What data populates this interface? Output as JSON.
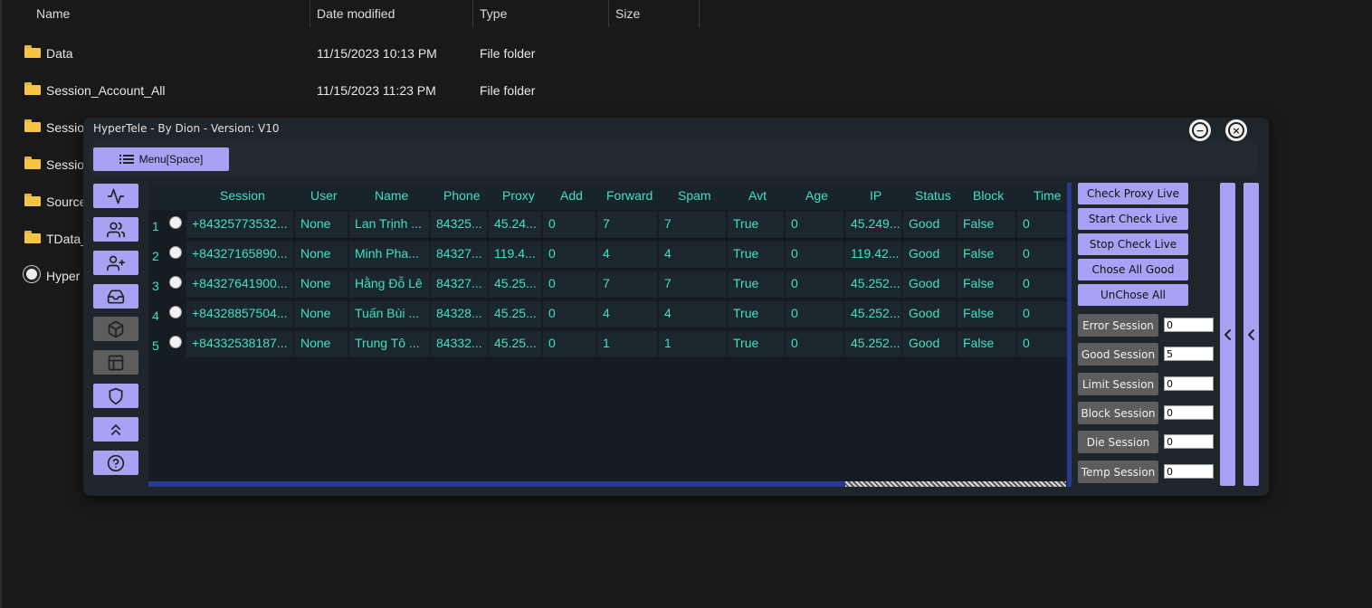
{
  "explorer": {
    "columns": {
      "name": "Name",
      "date": "Date modified",
      "type": "Type",
      "size": "Size"
    },
    "rows": [
      {
        "name": "Data",
        "date": "11/15/2023 10:13 PM",
        "type": "File folder"
      },
      {
        "name": "Session_Account_All",
        "date": "11/15/2023 11:23 PM",
        "type": "File folder"
      },
      {
        "name": "Sessio",
        "date": "",
        "type": ""
      },
      {
        "name": "Sessio",
        "date": "",
        "type": ""
      },
      {
        "name": "Source",
        "date": "",
        "type": ""
      },
      {
        "name": "TData_",
        "date": "",
        "type": ""
      },
      {
        "name": "Hyper",
        "date": "",
        "type": ""
      }
    ]
  },
  "window": {
    "title": "HyperTele - By Dion - Version: V10",
    "minimize_icon": "minus-circle-icon",
    "close_icon": "x-circle-icon"
  },
  "menu": {
    "label": "Menu[Space]",
    "icon": "menu-icon"
  },
  "nav": [
    {
      "icon": "activity-icon"
    },
    {
      "icon": "users-icon"
    },
    {
      "icon": "user-plus-icon"
    },
    {
      "icon": "inbox-icon"
    },
    {
      "icon": "box-icon"
    },
    {
      "icon": "layout-icon"
    },
    {
      "icon": "shield-icon"
    },
    {
      "icon": "chevrons-up-icon"
    },
    {
      "icon": "help-circle-icon"
    }
  ],
  "table": {
    "headers": [
      "Session",
      "User",
      "Name",
      "Phone",
      "Proxy",
      "Add",
      "Forward",
      "Spam",
      "Avt",
      "Age",
      "IP",
      "Status",
      "Block",
      "Time"
    ],
    "rows": [
      {
        "num": "1",
        "cells": [
          "+84325773532...",
          "None",
          "Lan Trịnh ...",
          "84325...",
          "45.24...",
          "0",
          "7",
          "7",
          "True",
          "0",
          "45.249...",
          "Good",
          "False",
          "0"
        ]
      },
      {
        "num": "2",
        "cells": [
          "+84327165890...",
          "None",
          "Minh Pha...",
          "84327...",
          "119.4...",
          "0",
          "4",
          "4",
          "True",
          "0",
          "119.42...",
          "Good",
          "False",
          "0"
        ]
      },
      {
        "num": "3",
        "cells": [
          "+84327641900...",
          "None",
          "Hằng Đỗ Lê",
          "84327...",
          "45.25...",
          "0",
          "7",
          "7",
          "True",
          "0",
          "45.252...",
          "Good",
          "False",
          "0"
        ]
      },
      {
        "num": "4",
        "cells": [
          "+84328857504...",
          "None",
          "Tuấn Bùi ...",
          "84328...",
          "45.25...",
          "0",
          "4",
          "4",
          "True",
          "0",
          "45.252...",
          "Good",
          "False",
          "0"
        ]
      },
      {
        "num": "5",
        "cells": [
          "+84332538187...",
          "None",
          "Trung Tô ...",
          "84332...",
          "45.25...",
          "0",
          "1",
          "1",
          "True",
          "0",
          "45.252...",
          "Good",
          "False",
          "0"
        ]
      }
    ]
  },
  "actions": {
    "check_proxy_live": "Check Proxy Live",
    "start_check_live": "Start Check Live",
    "stop_check_live": "Stop Check Live",
    "chose_all_good": "Chose All Good",
    "unchose_all": "UnChose All"
  },
  "sessions": [
    {
      "label": "Error Session",
      "value": "0"
    },
    {
      "label": "Good Session",
      "value": "5"
    },
    {
      "label": "Limit Session",
      "value": "0"
    },
    {
      "label": "Block Session",
      "value": "0"
    },
    {
      "label": "Die Session",
      "value": "0"
    },
    {
      "label": "Temp Session",
      "value": "0"
    }
  ],
  "collapse_icons": [
    "chevron-left-icon",
    "chevron-left-icon"
  ]
}
